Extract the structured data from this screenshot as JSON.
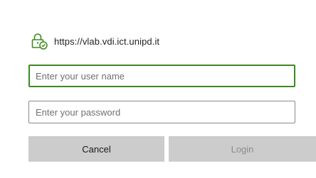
{
  "dialog": {
    "site_url": "https://vlab.vdi.ict.unipd.it",
    "site_icon": "secure-lock-check-icon",
    "accent_color": "#3d8b1f"
  },
  "fields": {
    "username": {
      "placeholder": "Enter your user name",
      "value": ""
    },
    "password": {
      "placeholder": "Enter your password",
      "value": ""
    }
  },
  "buttons": {
    "cancel_label": "Cancel",
    "login_label": "Login"
  }
}
